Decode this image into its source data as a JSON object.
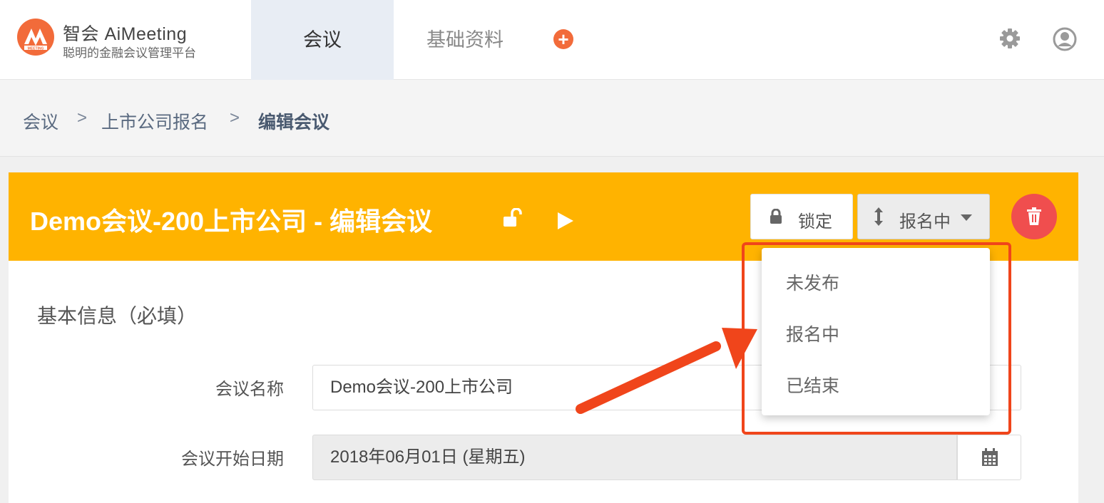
{
  "brand": {
    "name": "智会 AiMeeting",
    "slogan": "聪明的金融会议管理平台",
    "logo_text": "MEETING"
  },
  "nav": {
    "tabs": [
      {
        "label": "会议",
        "active": true
      },
      {
        "label": "基础资料",
        "active": false
      }
    ],
    "add_icon": "plus-circle-icon"
  },
  "header_icons": [
    "gear-icon",
    "user-avatar-icon"
  ],
  "breadcrumb": {
    "items": [
      "会议",
      "上市公司报名",
      "编辑会议"
    ],
    "separator": ">"
  },
  "panel": {
    "title": "Demo会议-200上市公司 - 编辑会议",
    "lock_label": "锁定",
    "status_label": "报名中",
    "header_color": "#ffb300"
  },
  "status_menu": {
    "options": [
      "未发布",
      "报名中",
      "已结束"
    ]
  },
  "form": {
    "section_title": "基本信息（必填）",
    "fields": [
      {
        "label": "会议名称",
        "value": "Demo会议-200上市公司"
      },
      {
        "label": "会议开始日期",
        "value": "2018年06月01日 (星期五)"
      }
    ]
  },
  "colors": {
    "accent_orange": "#f26b3a",
    "annotation_red": "#f0451b",
    "delete_red": "#f04e4e"
  }
}
